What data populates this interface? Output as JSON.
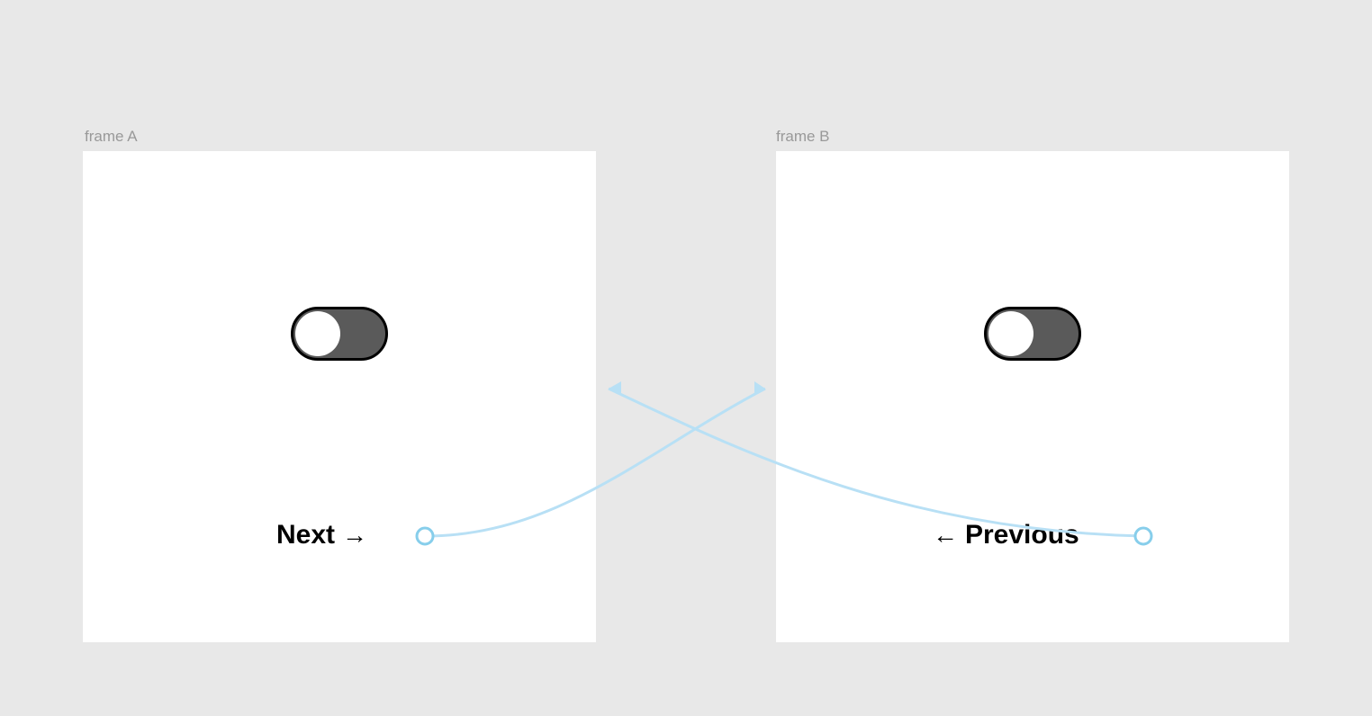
{
  "frames": {
    "a": {
      "label": "frame A",
      "nav_text": "Next",
      "nav_arrow": "→"
    },
    "b": {
      "label": "frame B",
      "nav_text": "Previous",
      "nav_arrow": "←"
    }
  },
  "colors": {
    "background": "#e8e8e8",
    "frame_bg": "#ffffff",
    "toggle_track": "#5a5a5a",
    "toggle_border": "#000000",
    "toggle_knob": "#ffffff",
    "connector": "#b8e0f5",
    "label_text": "#999999"
  }
}
